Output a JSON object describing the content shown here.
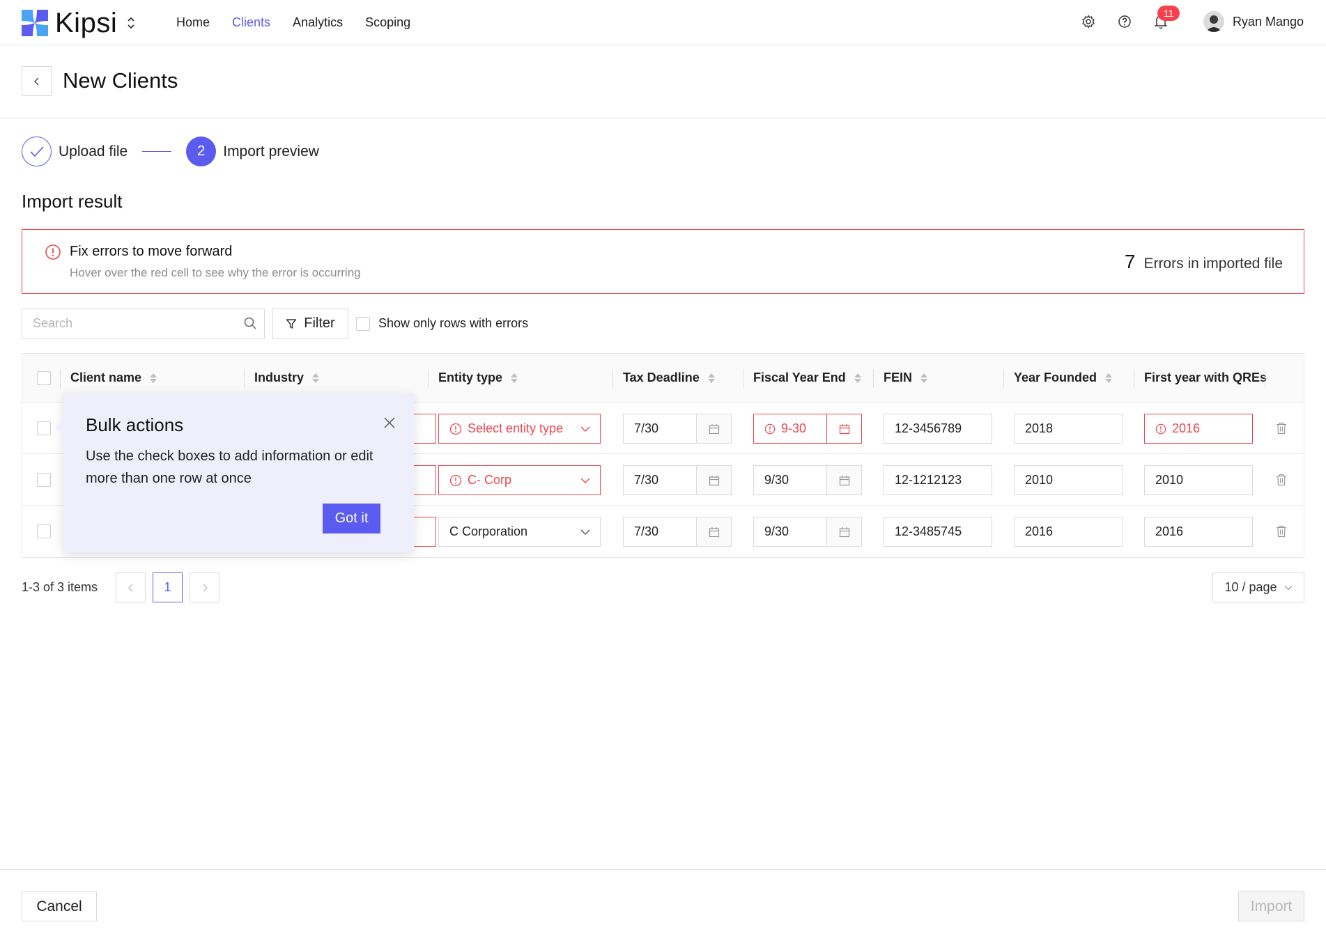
{
  "app": {
    "name": "Kipsi",
    "accent": "#5b5bf0",
    "error_color": "#f0464f"
  },
  "nav": {
    "items": [
      {
        "label": "Home",
        "active": false
      },
      {
        "label": "Clients",
        "active": true
      },
      {
        "label": "Analytics",
        "active": false
      },
      {
        "label": "Scoping",
        "active": false
      }
    ]
  },
  "topbar": {
    "notification_count": "11",
    "user_name": "Ryan Mango",
    "icons": [
      "gear-icon",
      "help-icon",
      "bell-icon"
    ]
  },
  "header": {
    "title": "New Clients"
  },
  "steps": [
    {
      "label": "Upload file",
      "state": "done"
    },
    {
      "number": "2",
      "label": "Import preview",
      "state": "active"
    }
  ],
  "import_result": {
    "title": "Import result",
    "error_title": "Fix errors to move forward",
    "error_subtitle": "Hover over the red cell to see why the error is occurring",
    "error_count": "7",
    "error_count_label": "Errors in imported file"
  },
  "toolbar": {
    "search_placeholder": "Search",
    "filter_label": "Filter",
    "show_errors_label": "Show only rows with errors"
  },
  "table": {
    "columns": [
      "Client name",
      "Industry",
      "Entity type",
      "Tax Deadline",
      "Fiscal Year End",
      "FEIN",
      "Year Founded",
      "First year with QREs"
    ],
    "rows": [
      {
        "entity_type": "Select entity type",
        "entity_error": true,
        "tax_deadline": "7/30",
        "fiscal_year_end": "9-30",
        "fiscal_error": true,
        "fein": "12-3456789",
        "year_founded": "2018",
        "first_year_qres": "2016",
        "qres_error": true
      },
      {
        "entity_type": "C- Corp",
        "entity_error": true,
        "tax_deadline": "7/30",
        "fiscal_year_end": "9/30",
        "fiscal_error": false,
        "fein": "12-1212123",
        "year_founded": "2010",
        "first_year_qres": "2010",
        "qres_error": false
      },
      {
        "entity_type": "C Corporation",
        "entity_error": false,
        "tax_deadline": "7/30",
        "fiscal_year_end": "9/30",
        "fiscal_error": false,
        "fein": "12-3485745",
        "year_founded": "2016",
        "first_year_qres": "2016",
        "qres_error": false
      }
    ]
  },
  "pagination": {
    "summary": "1-3 of 3 items",
    "current_page": "1",
    "page_size": "10 / page"
  },
  "popover": {
    "title": "Bulk actions",
    "text": "Use the check boxes to add information or edit more than one row at once",
    "button": "Got it"
  },
  "footer": {
    "cancel_label": "Cancel",
    "import_label": "Import"
  }
}
